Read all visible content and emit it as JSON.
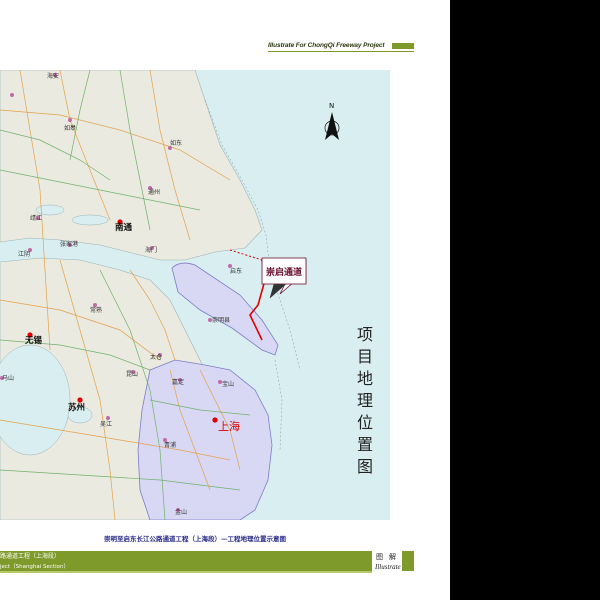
{
  "header": {
    "title": "Illustrate For ChongQi Freeway Project"
  },
  "map": {
    "places": {
      "haian": "海安",
      "rugao": "如皋",
      "rudong": "如东",
      "tongzhou": "通州",
      "jingjiang": "靖江",
      "jingjiang_short": "江阴",
      "zhangjiagang": "张家港",
      "nantong": "南通",
      "haimen": "海门",
      "qidong": "启东",
      "changshu": "常熟",
      "chongming": "崇明县",
      "wuxi": "无锡",
      "taicang": "太仓",
      "kunshan": "昆山",
      "jiading": "嘉定",
      "baoshan": "宝山",
      "mashan": "马山",
      "suzhou": "苏州",
      "shanghai": "上海",
      "wujiang": "吴江",
      "qingpu": "青浦",
      "jinshan": "金山"
    },
    "tunnel_callout": "崇启通道",
    "north_arrow": "N"
  },
  "side_title": [
    "项",
    "目",
    "地",
    "理",
    "位",
    "置",
    "图"
  ],
  "caption": "崇明至启东长江公路通道工程（上海段）—工程地理位置示意图",
  "footer": {
    "project_cn": "路通道工程（上海段）",
    "project_en": "ject（Shanghai Section）",
    "label_cn": "图解",
    "label_en": "Illustrate"
  },
  "colors": {
    "accent": "#7d9a2a",
    "land": "#eaeae0",
    "sea": "#d8eef1",
    "shanghai": "#d8d8f4",
    "route": "#e00000"
  }
}
